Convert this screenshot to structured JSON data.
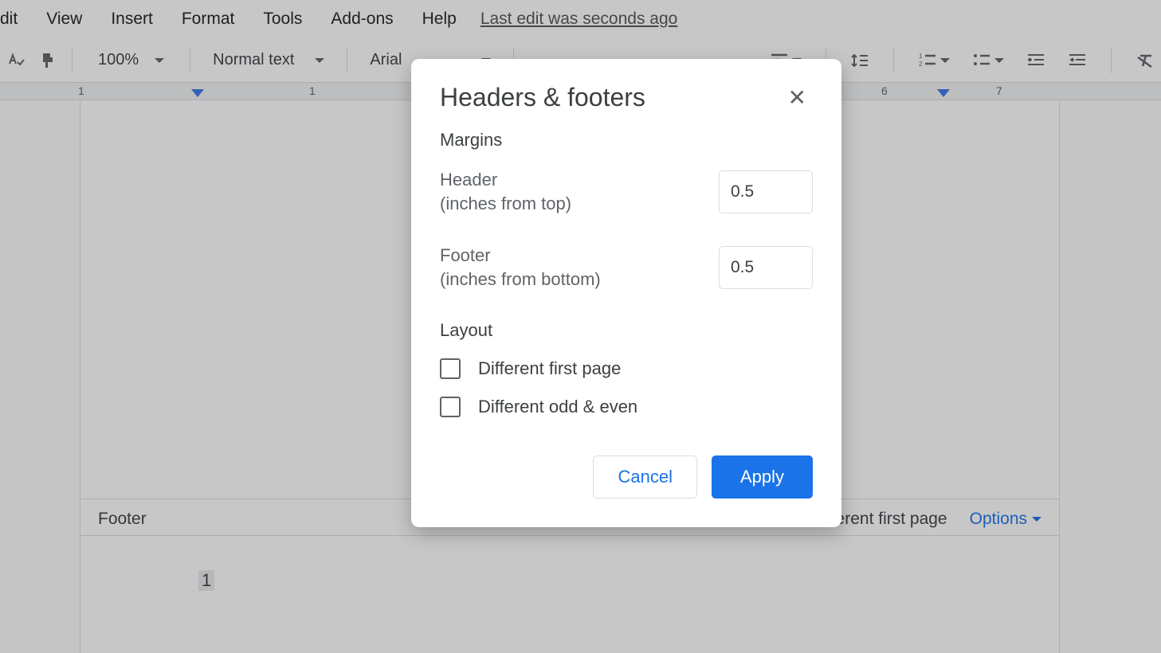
{
  "menubar": {
    "items": [
      "dit",
      "View",
      "Insert",
      "Format",
      "Tools",
      "Add-ons",
      "Help"
    ],
    "last_edit": "Last edit was seconds ago"
  },
  "toolbar": {
    "zoom": "100%",
    "style": "Normal text",
    "font": "Arial"
  },
  "ruler": {
    "numbers": [
      "1",
      "1",
      "6",
      "7"
    ]
  },
  "page": {
    "footer_label": "Footer",
    "dfp_text": "ferent first page",
    "options_label": "Options",
    "page_number": "1"
  },
  "dialog": {
    "title": "Headers & footers",
    "section_margins": "Margins",
    "header_label_line1": "Header",
    "header_label_line2": "(inches from top)",
    "header_value": "0.5",
    "footer_label_line1": "Footer",
    "footer_label_line2": "(inches from bottom)",
    "footer_value": "0.5",
    "section_layout": "Layout",
    "checkbox1_label": "Different first page",
    "checkbox2_label": "Different odd & even",
    "cancel_label": "Cancel",
    "apply_label": "Apply"
  }
}
